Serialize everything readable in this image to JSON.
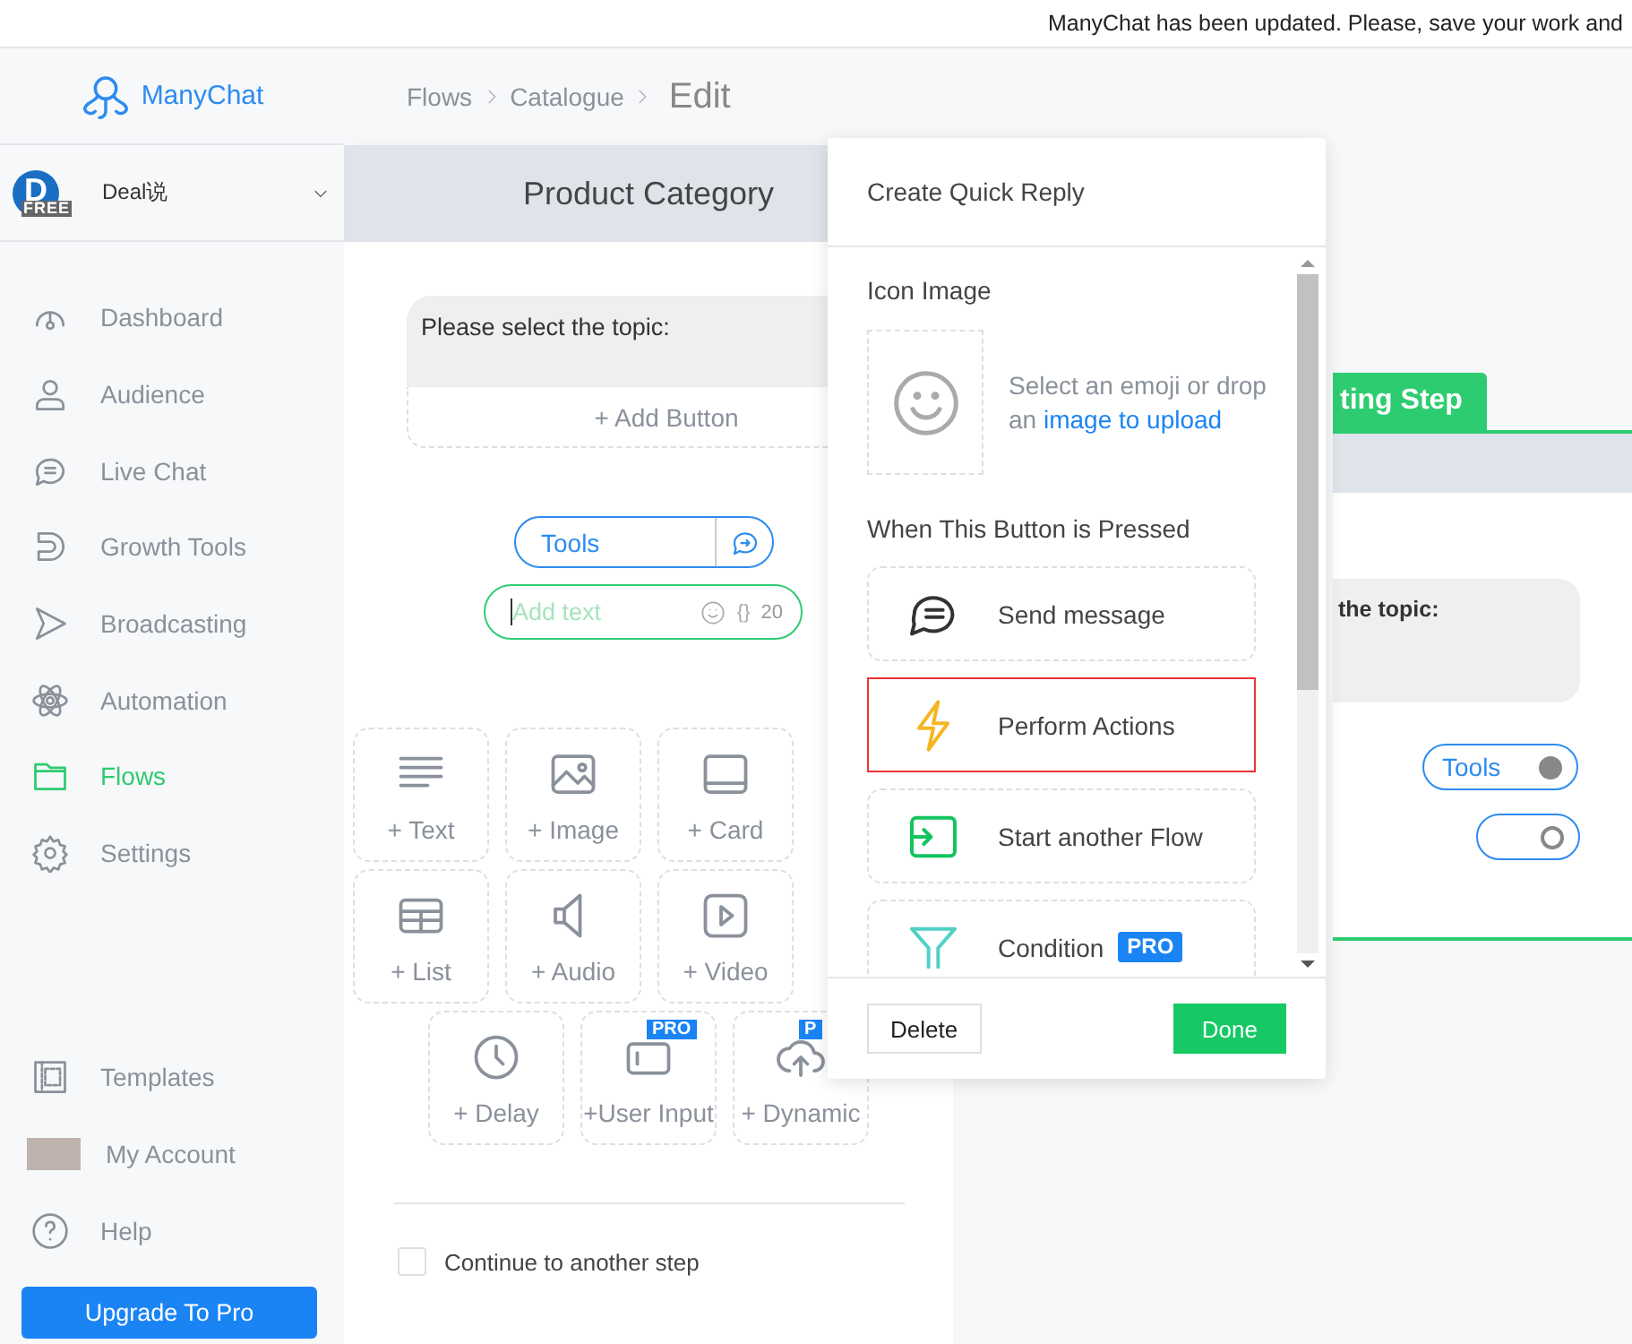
{
  "notice": "ManyChat has been updated. Please, save your work and",
  "logo": {
    "name": "ManyChat"
  },
  "account": {
    "avatar_letter": "D",
    "badge": "FREE",
    "name": "Deal说"
  },
  "sidebar": {
    "items": [
      {
        "label": "Dashboard",
        "selected": false
      },
      {
        "label": "Audience",
        "selected": false
      },
      {
        "label": "Live Chat",
        "selected": false
      },
      {
        "label": "Growth Tools",
        "selected": false
      },
      {
        "label": "Broadcasting",
        "selected": false
      },
      {
        "label": "Automation",
        "selected": false
      },
      {
        "label": "Flows",
        "selected": true
      },
      {
        "label": "Settings",
        "selected": false
      }
    ],
    "bottom_items": [
      {
        "label": "Templates"
      },
      {
        "label": "My Account"
      },
      {
        "label": "Help"
      }
    ],
    "upgrade_button": "Upgrade To Pro"
  },
  "breadcrumb": [
    "Flows",
    "Catalogue",
    "Edit"
  ],
  "editor": {
    "title": "Product Category",
    "message": "Please select the topic:",
    "add_button": "+ Add Button",
    "quick_reply": {
      "label": "Tools"
    },
    "new_reply": {
      "placeholder": "Add text",
      "variables": "{}",
      "counter": "20"
    },
    "blocks": [
      [
        {
          "label": "+ Text"
        },
        {
          "label": "+ Image"
        },
        {
          "label": "+ Card"
        }
      ],
      [
        {
          "label": "+ List"
        },
        {
          "label": "+ Audio"
        },
        {
          "label": "+ Video"
        }
      ],
      [
        {
          "label": "+ Delay"
        },
        {
          "label": "+User Input",
          "badge": "PRO"
        },
        {
          "label": "+ Dynamic",
          "badge": "P"
        }
      ]
    ],
    "continue": {
      "label": "Continue to another step",
      "checked": false
    }
  },
  "canvas": {
    "node": {
      "title": "ting Step",
      "message": "the topic:",
      "replies": [
        {
          "label": "Tools",
          "connected": true
        },
        {
          "connected": false
        }
      ]
    }
  },
  "popover": {
    "title": "Create Quick Reply",
    "icon_section": "Icon Image",
    "icon_hint": "Select an emoji or drop an",
    "icon_link": "image to upload",
    "action_section": "When This Button is Pressed",
    "actions": [
      {
        "label": "Send message",
        "selected": false
      },
      {
        "label": "Perform Actions",
        "selected": true
      },
      {
        "label": "Start another Flow",
        "selected": false
      },
      {
        "label": "Condition",
        "badge": "PRO",
        "selected": false
      }
    ],
    "delete_button": "Delete",
    "done_button": "Done"
  }
}
